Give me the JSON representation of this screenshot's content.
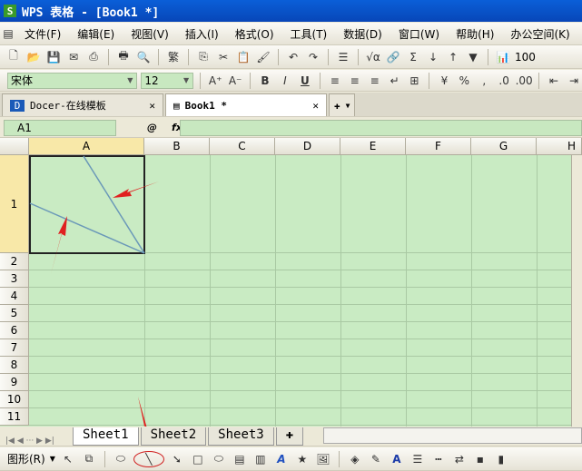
{
  "title": "WPS 表格 - [Book1 *]",
  "menu": [
    "文件(F)",
    "编辑(E)",
    "视图(V)",
    "插入(I)",
    "格式(O)",
    "工具(T)",
    "数据(D)",
    "窗口(W)",
    "帮助(H)",
    "办公空间(K)"
  ],
  "toolbar": {
    "zoom": "100"
  },
  "format": {
    "font": "宋体",
    "size": "12",
    "bold": "B",
    "italic": "I",
    "underline": "U",
    "percent": "%",
    "comma": ","
  },
  "tabs": [
    {
      "label": "Docer-在线模板"
    },
    {
      "label": "Book1 *"
    }
  ],
  "formula": {
    "namebox": "A1",
    "fx": "fx"
  },
  "columns": [
    "A",
    "B",
    "C",
    "D",
    "E",
    "F",
    "G",
    "H"
  ],
  "rows": [
    "1",
    "2",
    "3",
    "4",
    "5",
    "6",
    "7",
    "8",
    "9",
    "10",
    "11"
  ],
  "sheets": [
    "Sheet1",
    "Sheet2",
    "Sheet3"
  ],
  "draw": {
    "shapes_label": "图形(R)"
  },
  "colors": {
    "cell": "#c9ebc3",
    "arrow": "#e02020",
    "line": "#6a98b8"
  }
}
